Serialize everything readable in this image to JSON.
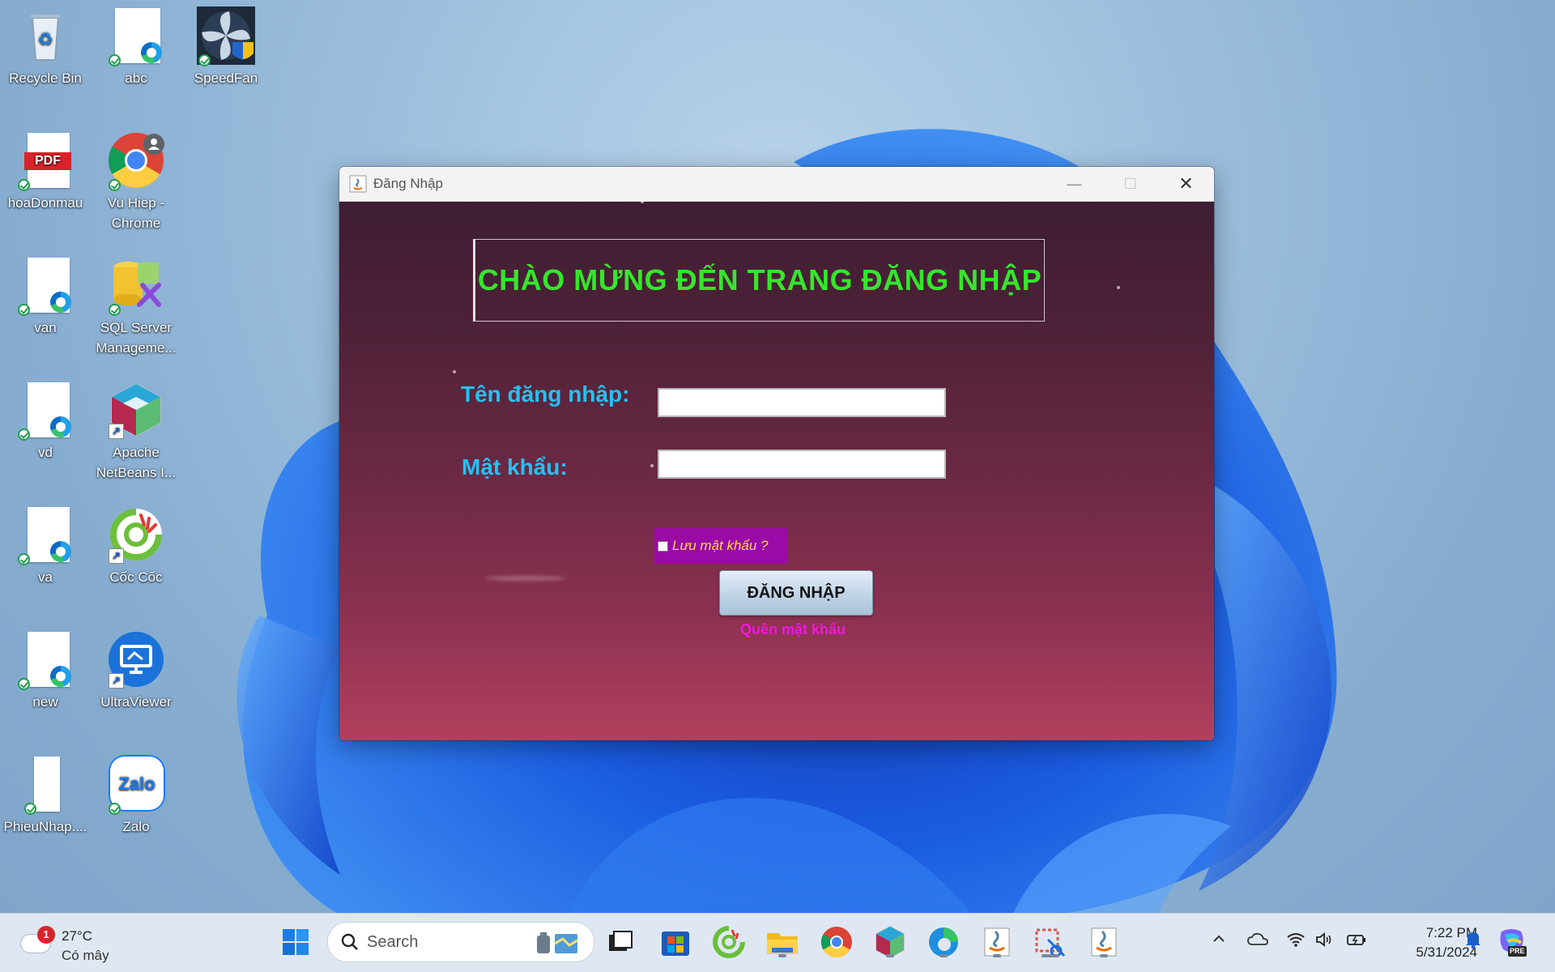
{
  "desktop": {
    "icons": [
      {
        "label": "Recycle Bin"
      },
      {
        "label": "abc"
      },
      {
        "label": "SpeedFan"
      },
      {
        "label": "hoaDonmau"
      },
      {
        "label": "Vu Hiep -\nChrome"
      },
      {
        "label": "van"
      },
      {
        "label": "SQL Server\nManageme..."
      },
      {
        "label": "vd"
      },
      {
        "label": "Apache\nNetBeans I..."
      },
      {
        "label": "va"
      },
      {
        "label": "Cốc Cốc"
      },
      {
        "label": "new"
      },
      {
        "label": "UltraViewer"
      },
      {
        "label": "PhieuNhap...."
      },
      {
        "label": "Zalo"
      }
    ],
    "pdf_badge": "PDF",
    "zalo_badge": "Zalo"
  },
  "window": {
    "title": "Đăng Nhập",
    "minimize": "—",
    "maximize": "☐",
    "close": "✕",
    "welcome": "CHÀO MỪNG ĐẾN TRANG ĐĂNG NHẬP",
    "username_label": "Tên đăng nhập:",
    "username_value": "",
    "password_label": "Mật khẩu:",
    "password_value": "",
    "remember_label": "Lưu mật khẩu ?",
    "remember_checked": false,
    "login_button": "ĐĂNG NHẬP",
    "forgot_link": "Quên mật khẩu"
  },
  "taskbar": {
    "weather_temp": "27°C",
    "weather_desc": "Có mây",
    "weather_badge": "1",
    "search_placeholder": "Search",
    "time": "7:22 PM",
    "date": "5/31/2024",
    "pre_badge": "PRE"
  },
  "colors": {
    "welcome": "#35e62c",
    "field_label": "#21c3f3",
    "remember_bg": "#9b0aa6",
    "remember_text": "#ffd84a",
    "forgot": "#ee18e0"
  }
}
